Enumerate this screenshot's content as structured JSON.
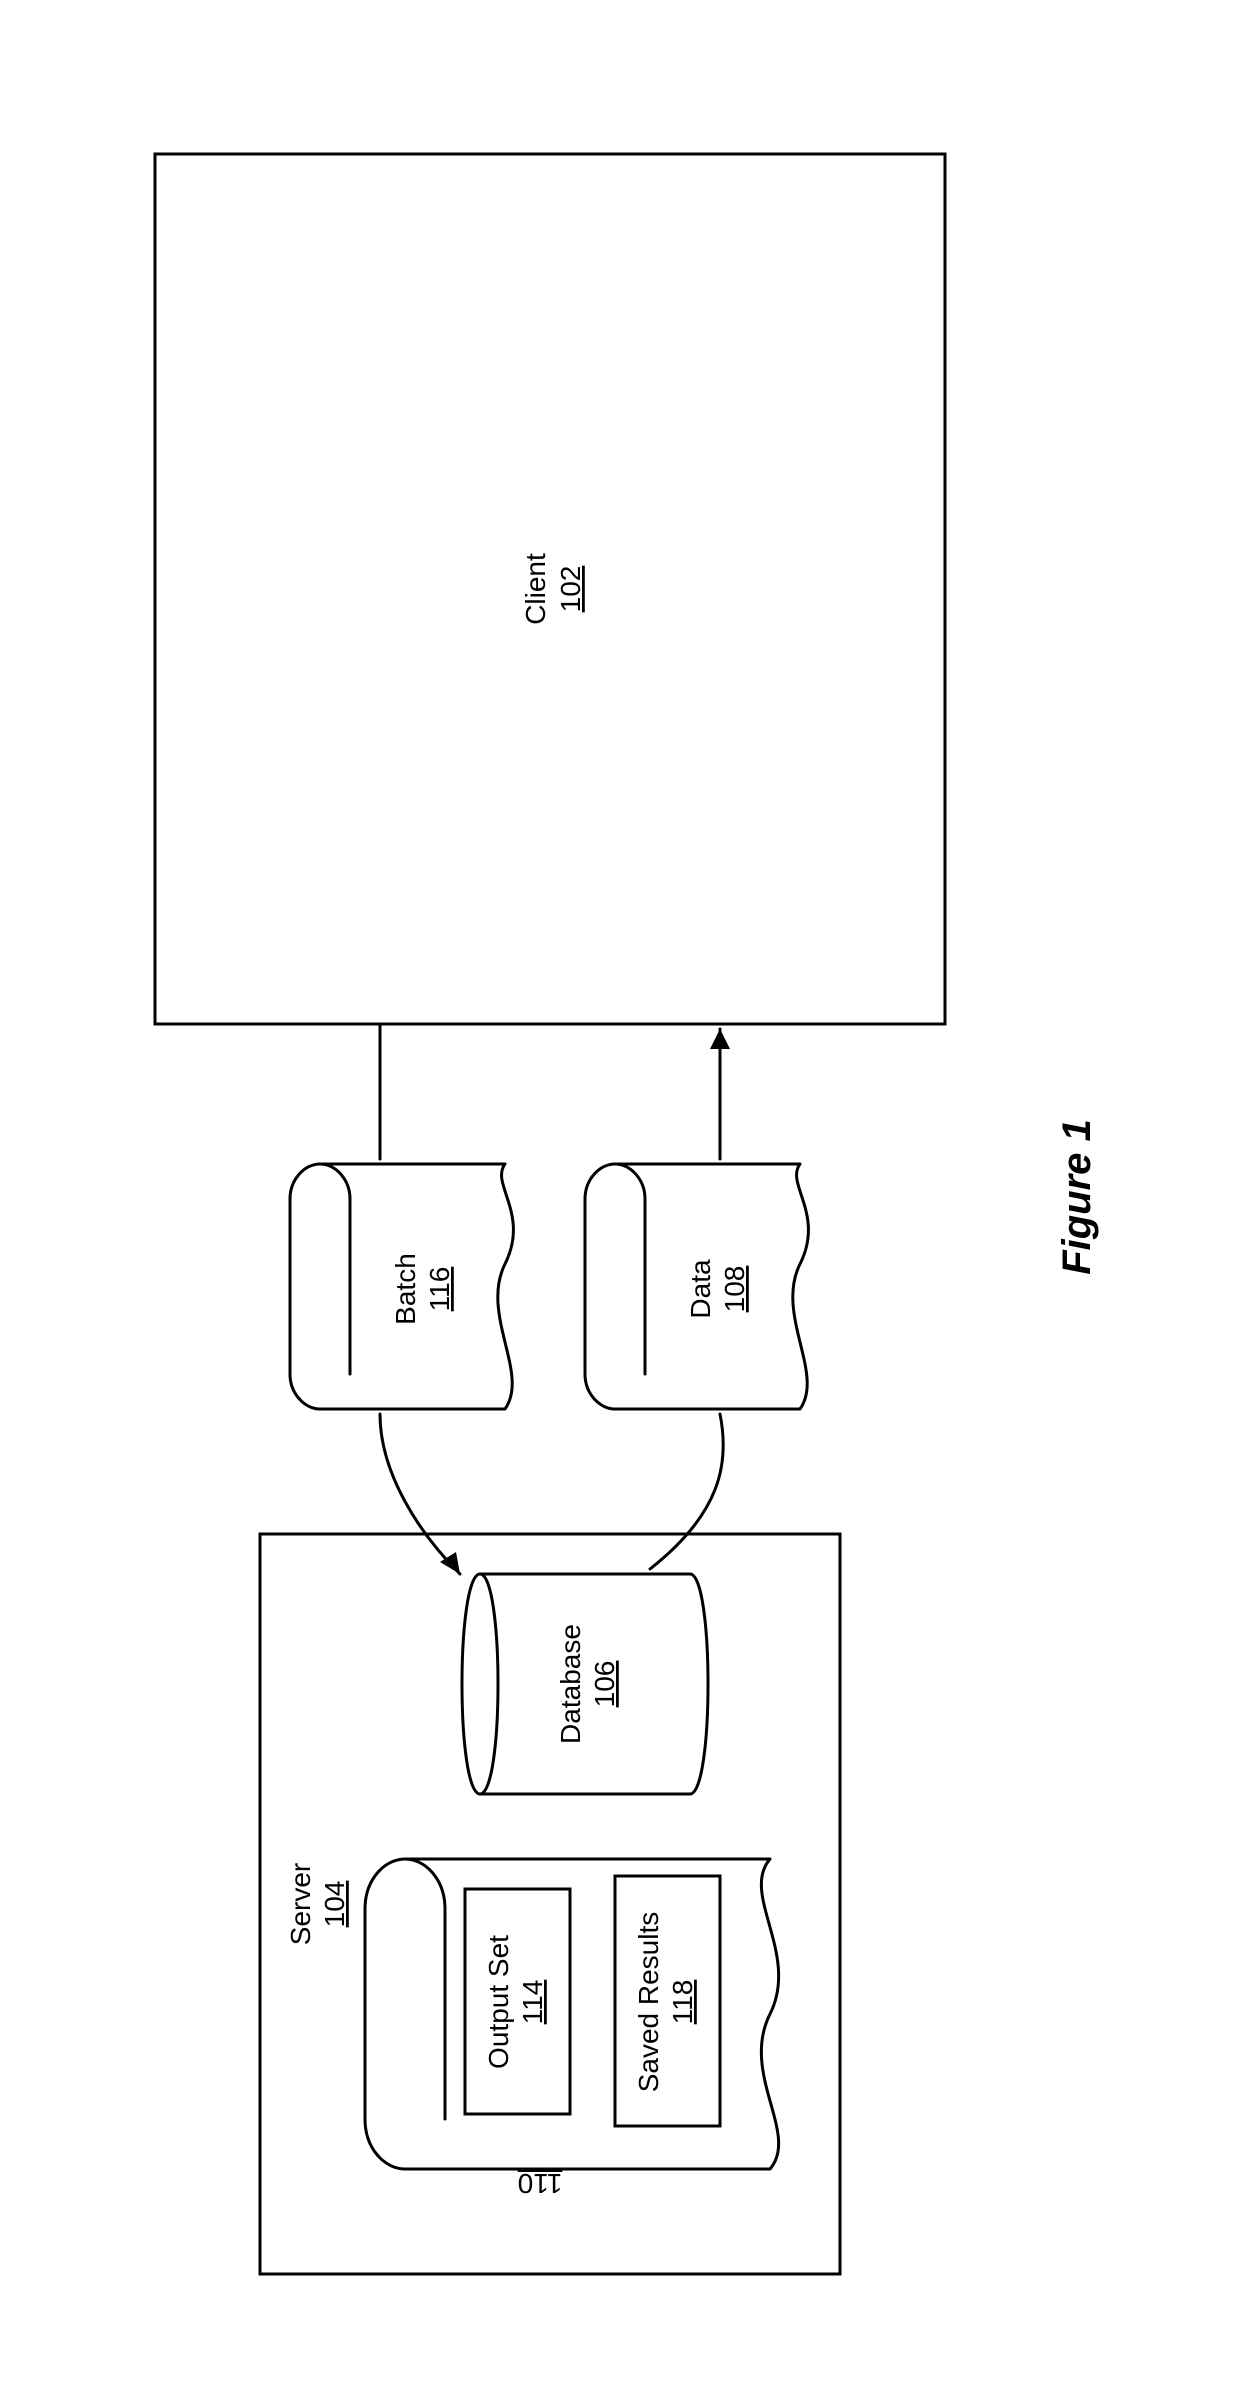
{
  "figure_label": "Figure 1",
  "client": {
    "label": "Client",
    "ref": "102"
  },
  "server": {
    "label": "Server",
    "ref": "104"
  },
  "database": {
    "label": "Database",
    "ref": "106"
  },
  "data_msg": {
    "label": "Data",
    "ref": "108"
  },
  "batch_msg": {
    "label": "Batch",
    "ref": "116"
  },
  "scroll": {
    "ref": "110"
  },
  "output_set": {
    "label": "Output Set",
    "ref": "114"
  },
  "saved_results": {
    "label": "Saved Results",
    "ref": "118"
  }
}
